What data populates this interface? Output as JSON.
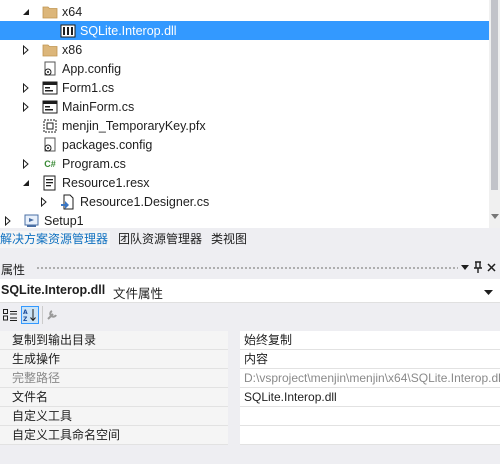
{
  "tree": {
    "items": [
      {
        "label": "x64"
      },
      {
        "label": "SQLite.Interop.dll"
      },
      {
        "label": "x86"
      },
      {
        "label": "App.config"
      },
      {
        "label": "Form1.cs"
      },
      {
        "label": "MainForm.cs"
      },
      {
        "label": "menjin_TemporaryKey.pfx"
      },
      {
        "label": "packages.config"
      },
      {
        "label": "Program.cs"
      },
      {
        "label": "Resource1.resx"
      },
      {
        "label": "Resource1.Designer.cs"
      },
      {
        "label": "Setup1"
      }
    ],
    "csharp_glyph": "C#"
  },
  "tabs": [
    "解决方案资源管理器",
    "团队资源管理器",
    "类视图"
  ],
  "properties": {
    "title": "属性",
    "object_name": "SQLite.Interop.dll",
    "object_type": "文件属性",
    "rows": [
      {
        "name": "复制到输出目录",
        "value": "始终复制"
      },
      {
        "name": "生成操作",
        "value": "内容"
      },
      {
        "name": "完整路径",
        "value": "D:\\vsproject\\menjin\\menjin\\x64\\SQLite.Interop.dll"
      },
      {
        "name": "文件名",
        "value": "SQLite.Interop.dll"
      },
      {
        "name": "自定义工具",
        "value": ""
      },
      {
        "name": "自定义工具命名空间",
        "value": ""
      }
    ]
  },
  "colors": {
    "selection": "#3399ff",
    "accent_tab": "#0e70c0",
    "panel_bg": "#eeeef2"
  }
}
